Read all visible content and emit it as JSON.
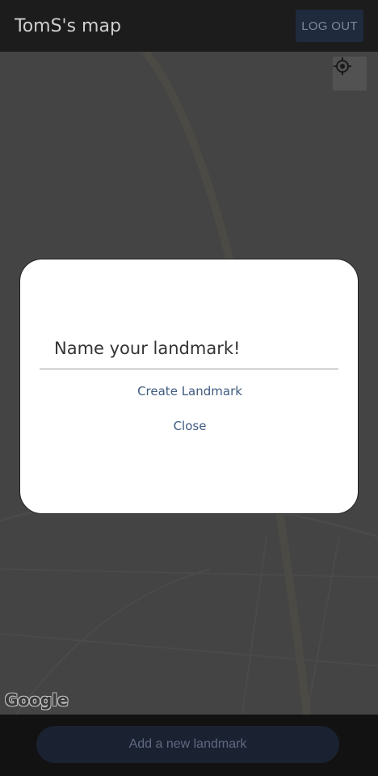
{
  "header": {
    "title": "TomS's map",
    "logout_label": "LOG OUT"
  },
  "map": {
    "locate_icon": "my-location-icon",
    "attribution": "Google"
  },
  "dialog": {
    "input_value": "Name your landmark!",
    "create_label": "Create Landmark",
    "close_label": "Close"
  },
  "footer": {
    "add_label": "Add a new landmark"
  },
  "colors": {
    "accent": "#3f5b80",
    "appbar": "#1c1c1c",
    "scrim_map": "#444444"
  }
}
